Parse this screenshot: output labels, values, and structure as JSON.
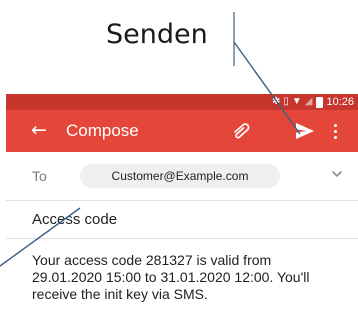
{
  "callout": {
    "label": "Senden"
  },
  "statusbar": {
    "time": "10:26"
  },
  "appbar": {
    "back_icon": "arrow-left-icon",
    "title": "Compose",
    "attach_icon": "paperclip-icon",
    "send_icon": "send-icon",
    "more_icon": "more-vert-icon"
  },
  "recipient": {
    "label": "To",
    "value": "Customer@Example.com"
  },
  "subject": "Access code",
  "body": "Your access code 281327 is valid from 29.01.2020 15:00 to 31.01.2020 12:00. You'll receive the init key via SMS.",
  "colors": {
    "statusbar": "#c7362c",
    "appbar": "#e4473a",
    "chip": "#efefef",
    "callout_line": "#3b5f86"
  }
}
